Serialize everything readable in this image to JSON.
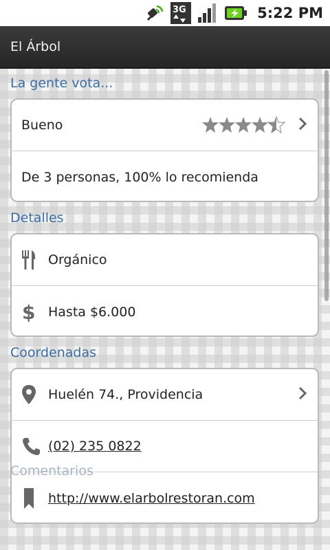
{
  "status_bar": {
    "time": "5:22 PM",
    "network_type": "3G",
    "icons": [
      "satellite-icon",
      "3g-data-icon",
      "signal-icon",
      "battery-charging-icon"
    ]
  },
  "title_bar": {
    "title": "El Árbol"
  },
  "sections": {
    "votes": {
      "header": "La gente vota...",
      "rating_label": "Bueno",
      "rating_value": 4.5,
      "rating_max": 5,
      "summary": "De 3 personas, 100% lo recomienda"
    },
    "details": {
      "header": "Detalles",
      "cuisine": "Orgánico",
      "price": "Hasta $6.000"
    },
    "coordinates": {
      "header": "Coordenadas",
      "address": "Huelén 74., Providencia",
      "phone": "(02) 235 0822",
      "website": "http://www.elarbolrestoran.com"
    },
    "comments": {
      "header": "Comentarios"
    }
  },
  "colors": {
    "section_header": "#3a6ea5",
    "link": "#3f3fc0",
    "title_bar": "#2e2e2e",
    "icon_gray": "#8a8a8a"
  }
}
